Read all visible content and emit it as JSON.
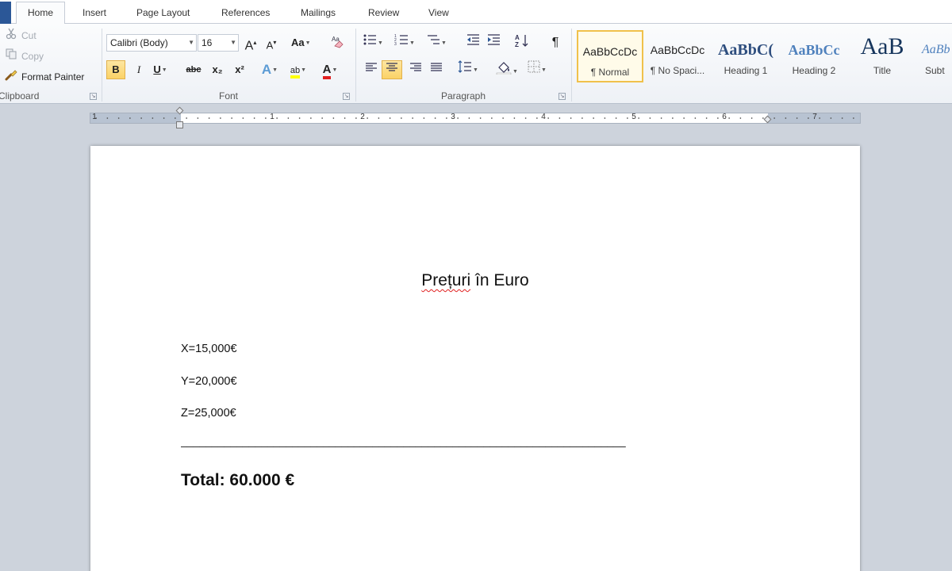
{
  "tabs": [
    {
      "label": "Home",
      "active": true
    },
    {
      "label": "Insert"
    },
    {
      "label": "Page Layout"
    },
    {
      "label": "References"
    },
    {
      "label": "Mailings"
    },
    {
      "label": "Review"
    },
    {
      "label": "View"
    }
  ],
  "clipboard": {
    "cut": "Cut",
    "copy": "Copy",
    "format_painter": "Format Painter",
    "group_label": "Clipboard"
  },
  "font": {
    "family": "Calibri (Body)",
    "size": "16",
    "group_label": "Font",
    "grow_label": "A",
    "shrink_label": "A",
    "case_label": "Aa",
    "bold_label": "B",
    "italic_label": "I",
    "underline_label": "U",
    "strike_label": "abc",
    "subscript_label": "x₂",
    "superscript_label": "x²",
    "effects_label": "A",
    "highlight_label": "ab",
    "color_label": "A"
  },
  "paragraph": {
    "group_label": "Paragraph",
    "show_marks_label": "¶"
  },
  "styles": [
    {
      "sample": "AaBbCcDc",
      "name": "¶ Normal",
      "selected": true
    },
    {
      "sample": "AaBbCcDc",
      "name": "¶ No Spaci..."
    },
    {
      "sample": "AaBbC(",
      "name": "Heading 1"
    },
    {
      "sample": "AaBbCc",
      "name": "Heading 2"
    },
    {
      "sample": "AaB",
      "name": "Title"
    },
    {
      "sample": "AaBb",
      "name": "Subt"
    }
  ],
  "ruler": {
    "numbers": [
      "1",
      "1",
      "2",
      "3",
      "4",
      "5",
      "6",
      "7"
    ]
  },
  "document": {
    "title_word1": "Prețuri",
    "title_rest": " în Euro",
    "lines": [
      " X=15,000€",
      "Y=20,000€",
      "Z=25,000€"
    ],
    "separator": "________________________________________________________________________",
    "total": "Total:  60.000 €"
  },
  "colors": {
    "accent": "#2b5797",
    "selected_style_border": "#f0c14b",
    "pressed_button": "#fbd266",
    "highlight_yellow": "#ffff00",
    "font_color_red": "#e02020"
  }
}
